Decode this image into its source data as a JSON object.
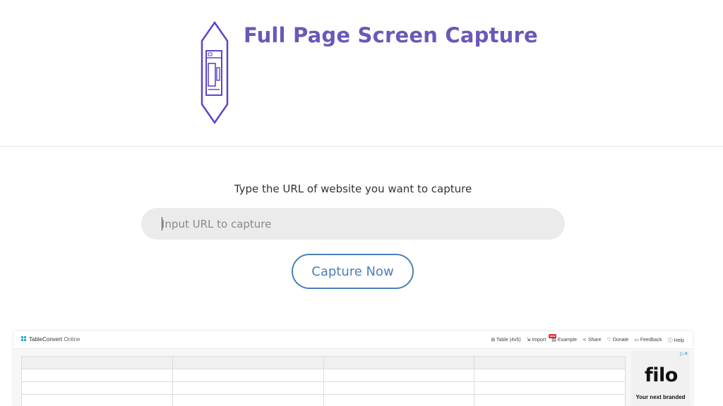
{
  "header": {
    "title": "Full Page Screen Capture",
    "logo_icon": "browser-window-icon",
    "brand_color": "#6a58b8"
  },
  "capture": {
    "prompt": "Type the URL of website you want to capture",
    "url_placeholder": "Input URL to capture",
    "url_value": "",
    "button_label": "Capture Now",
    "button_color": "#4a7fb8"
  },
  "preview": {
    "brand_name": "TableConvert",
    "brand_suffix": " Online",
    "menu": [
      {
        "icon": "table-icon",
        "label": "Table (4x5)"
      },
      {
        "icon": "import-icon",
        "label": "Import",
        "badge": "new"
      },
      {
        "icon": "example-icon",
        "label": "Example"
      },
      {
        "icon": "share-icon",
        "label": "Share"
      },
      {
        "icon": "donate-icon",
        "label": "Donate"
      },
      {
        "icon": "feedback-icon",
        "label": "Feedback"
      },
      {
        "icon": "help-icon",
        "label": "Help"
      }
    ],
    "ad": {
      "mark": "▷✕",
      "logo": "filo",
      "text": "Your next branded"
    }
  }
}
